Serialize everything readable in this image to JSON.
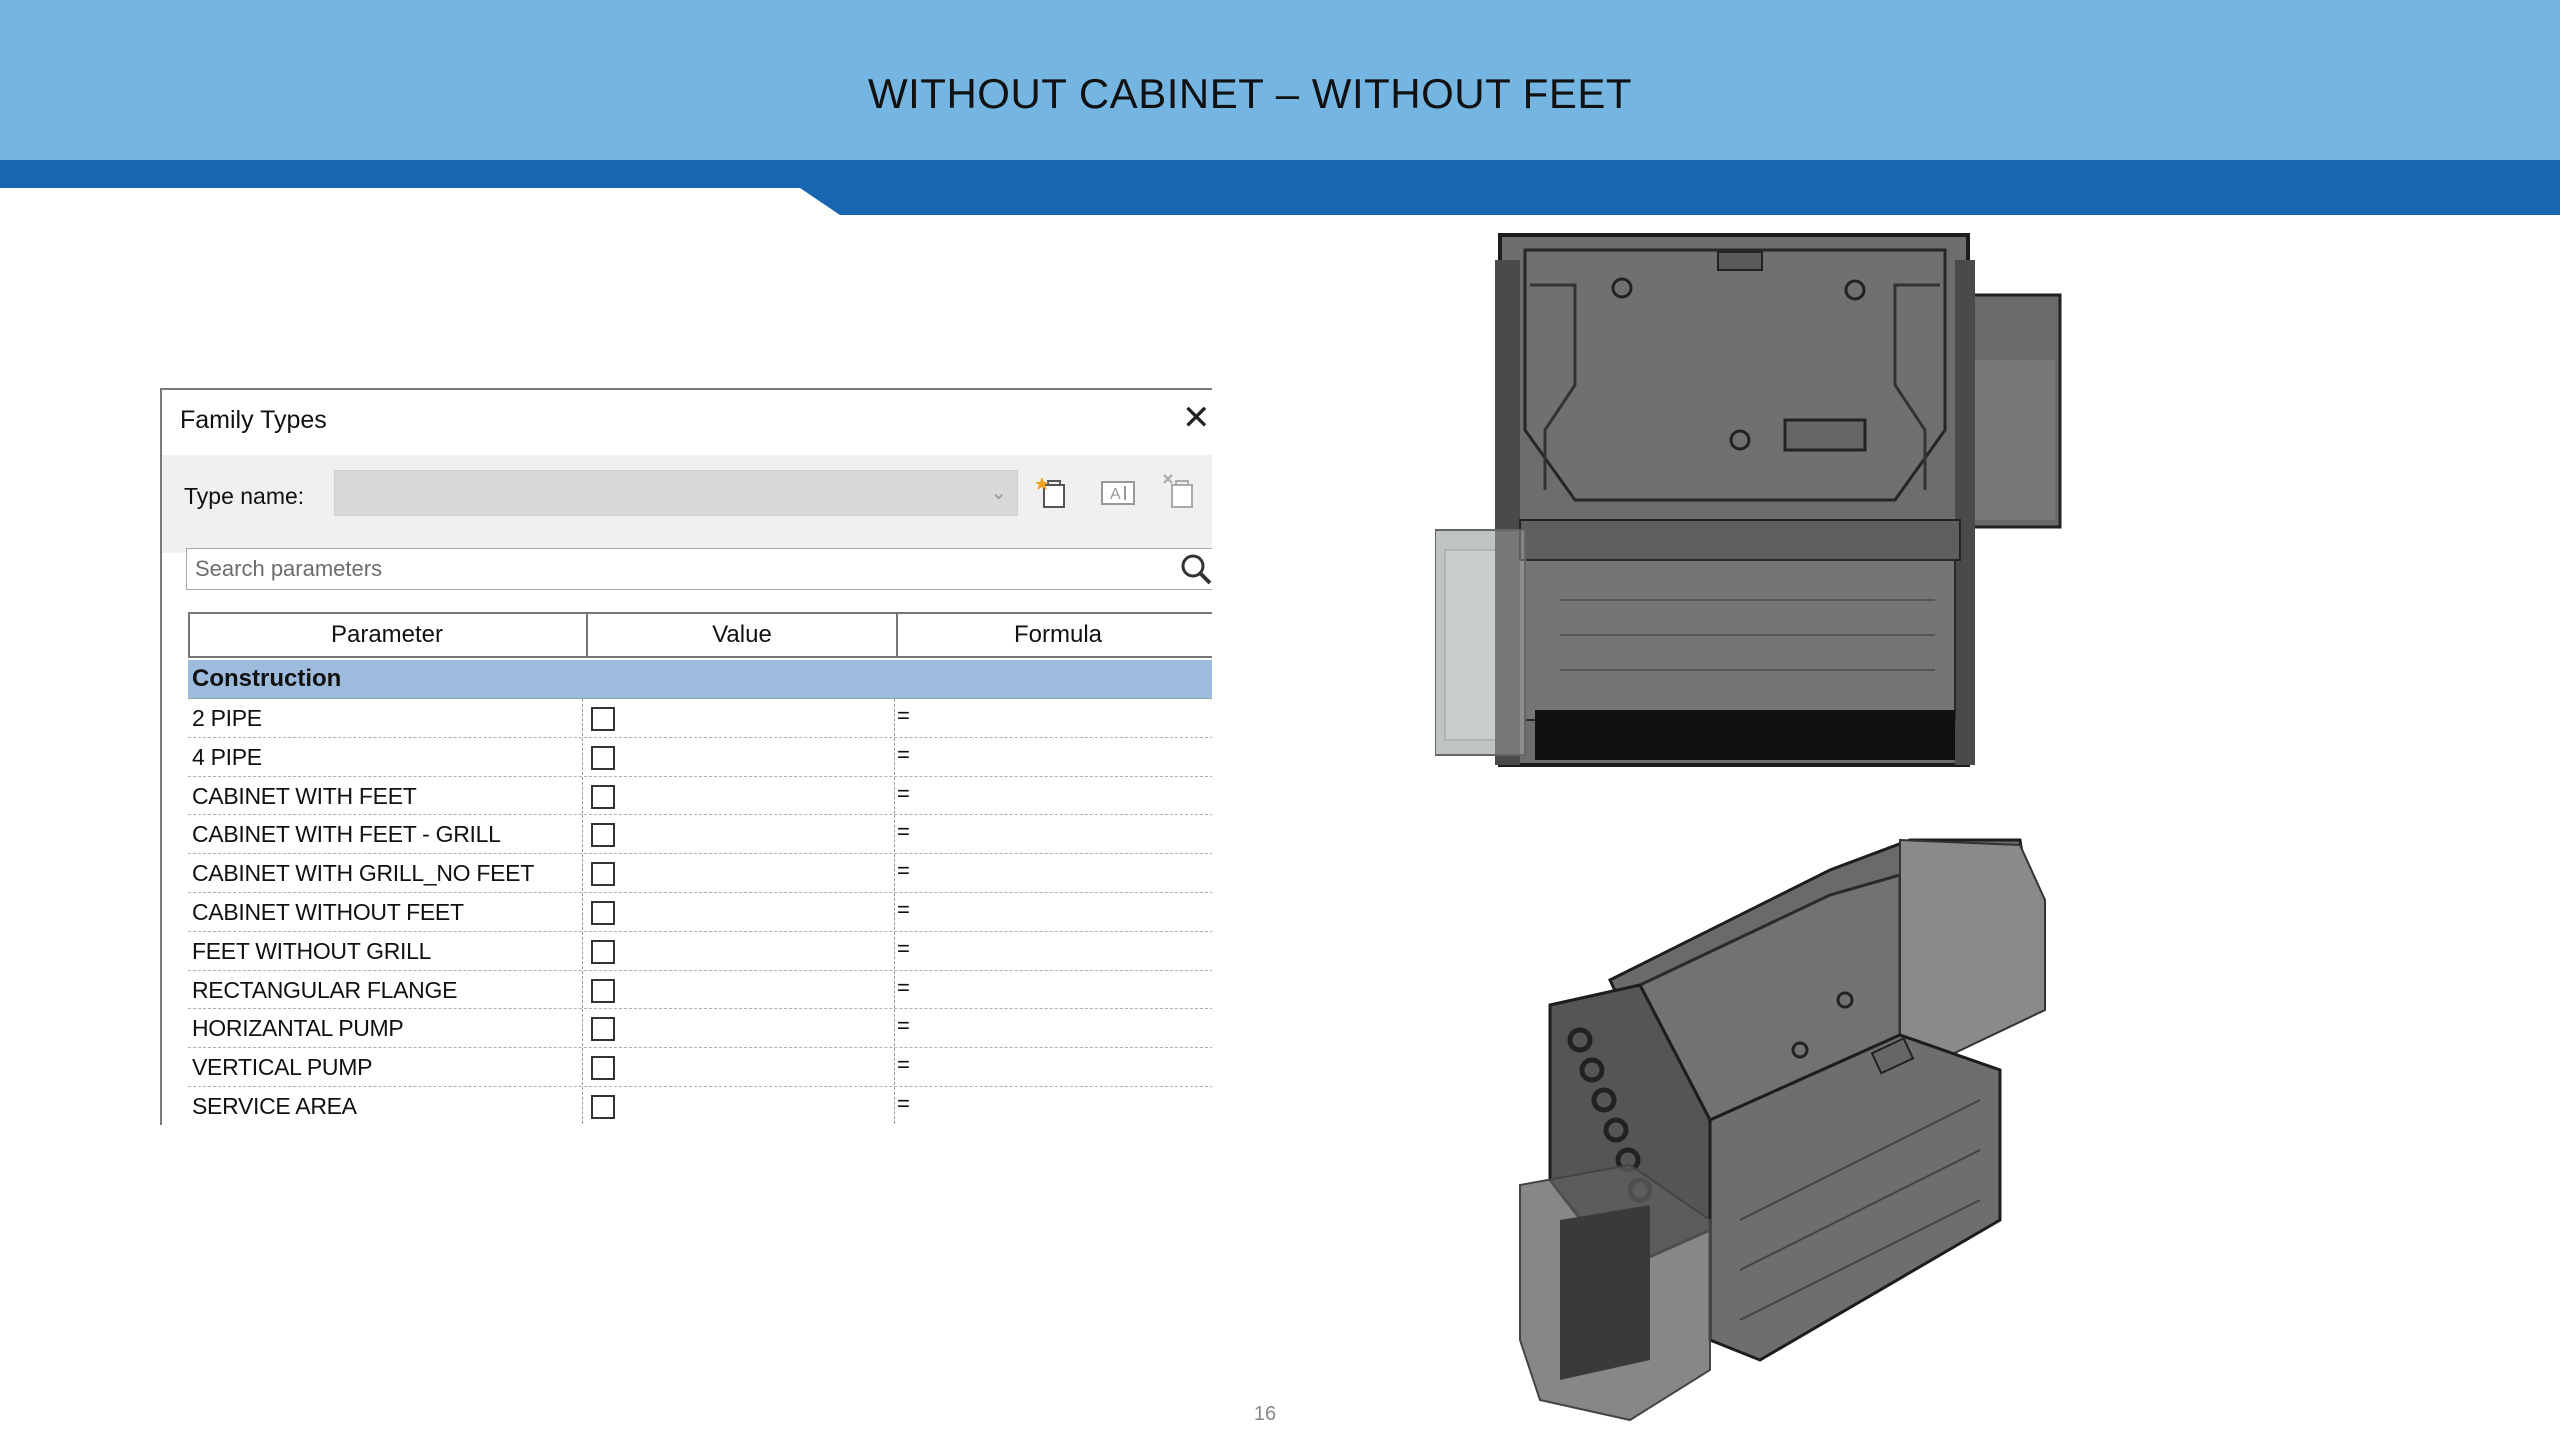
{
  "slide": {
    "title": "WITHOUT CABINET – WITHOUT FEET",
    "page_number": "16",
    "colors": {
      "header_light": "#74b6e1",
      "header_dark": "#1766b1"
    }
  },
  "dialog": {
    "title": "Family Types",
    "close_icon": "close-icon",
    "type_name_label": "Type name:",
    "type_name_value": "",
    "toolbar_icons": [
      "new-type-icon",
      "rename-type-icon",
      "delete-type-icon"
    ],
    "search_placeholder": "Search parameters",
    "columns": {
      "parameter": "Parameter",
      "value": "Value",
      "formula": "Formula"
    },
    "group": "Construction",
    "rows": [
      {
        "parameter": "2 PIPE",
        "checked": false,
        "formula": "="
      },
      {
        "parameter": "4 PIPE",
        "checked": false,
        "formula": "="
      },
      {
        "parameter": "CABINET WITH FEET",
        "checked": false,
        "formula": "="
      },
      {
        "parameter": "CABINET WITH FEET - GRILL",
        "checked": false,
        "formula": "="
      },
      {
        "parameter": "CABINET WITH GRILL_NO FEET",
        "checked": false,
        "formula": "="
      },
      {
        "parameter": "CABINET WITHOUT FEET",
        "checked": false,
        "formula": "="
      },
      {
        "parameter": "FEET WITHOUT GRILL",
        "checked": false,
        "formula": "="
      },
      {
        "parameter": "RECTANGULAR FLANGE",
        "checked": false,
        "formula": "="
      },
      {
        "parameter": "HORIZANTAL PUMP",
        "checked": false,
        "formula": "="
      },
      {
        "parameter": "VERTICAL PUMP",
        "checked": false,
        "formula": "="
      },
      {
        "parameter": "SERVICE AREA",
        "checked": false,
        "formula": "="
      }
    ]
  }
}
